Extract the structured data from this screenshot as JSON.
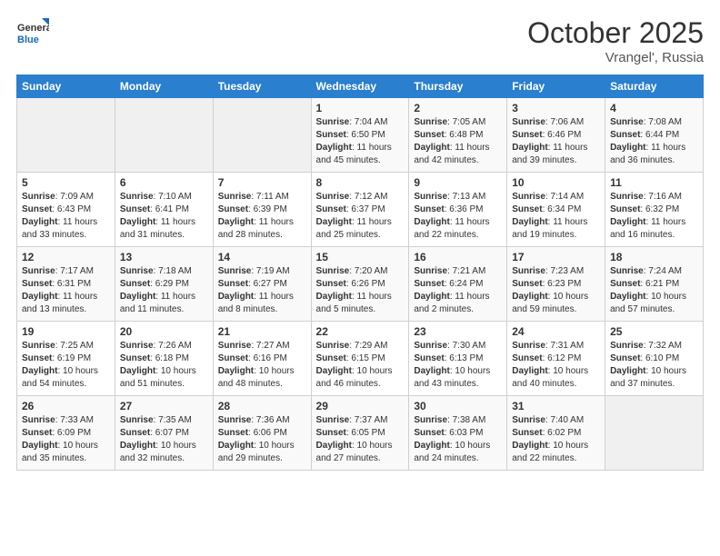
{
  "header": {
    "logo_general": "General",
    "logo_blue": "Blue",
    "month": "October 2025",
    "location": "Vrangel', Russia"
  },
  "days_of_week": [
    "Sunday",
    "Monday",
    "Tuesday",
    "Wednesday",
    "Thursday",
    "Friday",
    "Saturday"
  ],
  "weeks": [
    [
      {
        "day": "",
        "info": ""
      },
      {
        "day": "",
        "info": ""
      },
      {
        "day": "",
        "info": ""
      },
      {
        "day": "1",
        "info": "Sunrise: 7:04 AM\nSunset: 6:50 PM\nDaylight: 11 hours and 45 minutes."
      },
      {
        "day": "2",
        "info": "Sunrise: 7:05 AM\nSunset: 6:48 PM\nDaylight: 11 hours and 42 minutes."
      },
      {
        "day": "3",
        "info": "Sunrise: 7:06 AM\nSunset: 6:46 PM\nDaylight: 11 hours and 39 minutes."
      },
      {
        "day": "4",
        "info": "Sunrise: 7:08 AM\nSunset: 6:44 PM\nDaylight: 11 hours and 36 minutes."
      }
    ],
    [
      {
        "day": "5",
        "info": "Sunrise: 7:09 AM\nSunset: 6:43 PM\nDaylight: 11 hours and 33 minutes."
      },
      {
        "day": "6",
        "info": "Sunrise: 7:10 AM\nSunset: 6:41 PM\nDaylight: 11 hours and 31 minutes."
      },
      {
        "day": "7",
        "info": "Sunrise: 7:11 AM\nSunset: 6:39 PM\nDaylight: 11 hours and 28 minutes."
      },
      {
        "day": "8",
        "info": "Sunrise: 7:12 AM\nSunset: 6:37 PM\nDaylight: 11 hours and 25 minutes."
      },
      {
        "day": "9",
        "info": "Sunrise: 7:13 AM\nSunset: 6:36 PM\nDaylight: 11 hours and 22 minutes."
      },
      {
        "day": "10",
        "info": "Sunrise: 7:14 AM\nSunset: 6:34 PM\nDaylight: 11 hours and 19 minutes."
      },
      {
        "day": "11",
        "info": "Sunrise: 7:16 AM\nSunset: 6:32 PM\nDaylight: 11 hours and 16 minutes."
      }
    ],
    [
      {
        "day": "12",
        "info": "Sunrise: 7:17 AM\nSunset: 6:31 PM\nDaylight: 11 hours and 13 minutes."
      },
      {
        "day": "13",
        "info": "Sunrise: 7:18 AM\nSunset: 6:29 PM\nDaylight: 11 hours and 11 minutes."
      },
      {
        "day": "14",
        "info": "Sunrise: 7:19 AM\nSunset: 6:27 PM\nDaylight: 11 hours and 8 minutes."
      },
      {
        "day": "15",
        "info": "Sunrise: 7:20 AM\nSunset: 6:26 PM\nDaylight: 11 hours and 5 minutes."
      },
      {
        "day": "16",
        "info": "Sunrise: 7:21 AM\nSunset: 6:24 PM\nDaylight: 11 hours and 2 minutes."
      },
      {
        "day": "17",
        "info": "Sunrise: 7:23 AM\nSunset: 6:23 PM\nDaylight: 10 hours and 59 minutes."
      },
      {
        "day": "18",
        "info": "Sunrise: 7:24 AM\nSunset: 6:21 PM\nDaylight: 10 hours and 57 minutes."
      }
    ],
    [
      {
        "day": "19",
        "info": "Sunrise: 7:25 AM\nSunset: 6:19 PM\nDaylight: 10 hours and 54 minutes."
      },
      {
        "day": "20",
        "info": "Sunrise: 7:26 AM\nSunset: 6:18 PM\nDaylight: 10 hours and 51 minutes."
      },
      {
        "day": "21",
        "info": "Sunrise: 7:27 AM\nSunset: 6:16 PM\nDaylight: 10 hours and 48 minutes."
      },
      {
        "day": "22",
        "info": "Sunrise: 7:29 AM\nSunset: 6:15 PM\nDaylight: 10 hours and 46 minutes."
      },
      {
        "day": "23",
        "info": "Sunrise: 7:30 AM\nSunset: 6:13 PM\nDaylight: 10 hours and 43 minutes."
      },
      {
        "day": "24",
        "info": "Sunrise: 7:31 AM\nSunset: 6:12 PM\nDaylight: 10 hours and 40 minutes."
      },
      {
        "day": "25",
        "info": "Sunrise: 7:32 AM\nSunset: 6:10 PM\nDaylight: 10 hours and 37 minutes."
      }
    ],
    [
      {
        "day": "26",
        "info": "Sunrise: 7:33 AM\nSunset: 6:09 PM\nDaylight: 10 hours and 35 minutes."
      },
      {
        "day": "27",
        "info": "Sunrise: 7:35 AM\nSunset: 6:07 PM\nDaylight: 10 hours and 32 minutes."
      },
      {
        "day": "28",
        "info": "Sunrise: 7:36 AM\nSunset: 6:06 PM\nDaylight: 10 hours and 29 minutes."
      },
      {
        "day": "29",
        "info": "Sunrise: 7:37 AM\nSunset: 6:05 PM\nDaylight: 10 hours and 27 minutes."
      },
      {
        "day": "30",
        "info": "Sunrise: 7:38 AM\nSunset: 6:03 PM\nDaylight: 10 hours and 24 minutes."
      },
      {
        "day": "31",
        "info": "Sunrise: 7:40 AM\nSunset: 6:02 PM\nDaylight: 10 hours and 22 minutes."
      },
      {
        "day": "",
        "info": ""
      }
    ]
  ]
}
